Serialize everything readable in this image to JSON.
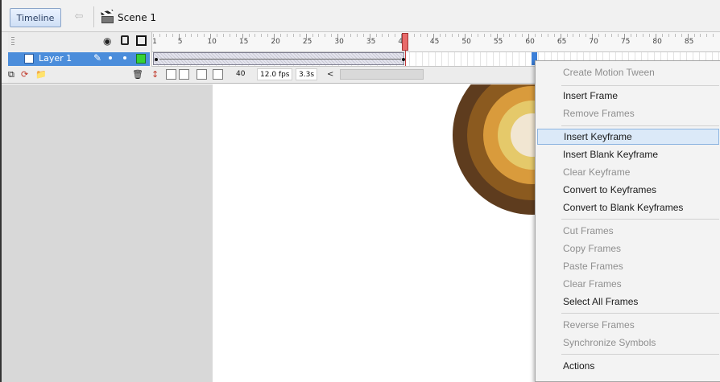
{
  "topbar": {
    "timeline_button": "Timeline",
    "back_arrow": "⇦",
    "scene_label": "Scene 1"
  },
  "timeline": {
    "header_icons": [
      "eye-icon",
      "lock-icon",
      "outline-icon"
    ],
    "ruler_labels": [
      "1",
      "5",
      "10",
      "15",
      "20",
      "25",
      "30",
      "35",
      "40",
      "45",
      "50",
      "55",
      "60",
      "65",
      "70",
      "75",
      "80",
      "85"
    ],
    "layer": {
      "name": "Layer 1"
    },
    "footer": {
      "current_frame": "40",
      "frame_rate": "12.0 fps",
      "elapsed_time": "3.3s",
      "scroll_left": "<"
    }
  },
  "context_menu": {
    "items": [
      {
        "label": "Create Motion Tween",
        "enabled": false
      },
      {
        "label": "Insert Frame",
        "enabled": true
      },
      {
        "label": "Remove Frames",
        "enabled": false
      },
      {
        "label": "Insert Keyframe",
        "enabled": true,
        "highlighted": true
      },
      {
        "label": "Insert Blank Keyframe",
        "enabled": true
      },
      {
        "label": "Clear Keyframe",
        "enabled": false
      },
      {
        "label": "Convert to Keyframes",
        "enabled": true
      },
      {
        "label": "Convert to Blank Keyframes",
        "enabled": true
      },
      {
        "label": "Cut Frames",
        "enabled": false
      },
      {
        "label": "Copy Frames",
        "enabled": false
      },
      {
        "label": "Paste Frames",
        "enabled": false
      },
      {
        "label": "Clear Frames",
        "enabled": false
      },
      {
        "label": "Select All Frames",
        "enabled": true
      },
      {
        "label": "Reverse Frames",
        "enabled": false
      },
      {
        "label": "Synchronize Symbols",
        "enabled": false
      },
      {
        "label": "Actions",
        "enabled": true
      }
    ]
  },
  "colors": {
    "layer_selected": "#4b8ddb",
    "playhead": "#e86a6a",
    "ring_outer": "#5e3c1e",
    "ring_2": "#8b5a1f",
    "ring_3": "#d99b3c",
    "ring_4": "#e5c96a",
    "ring_center": "#f1e6d2"
  }
}
